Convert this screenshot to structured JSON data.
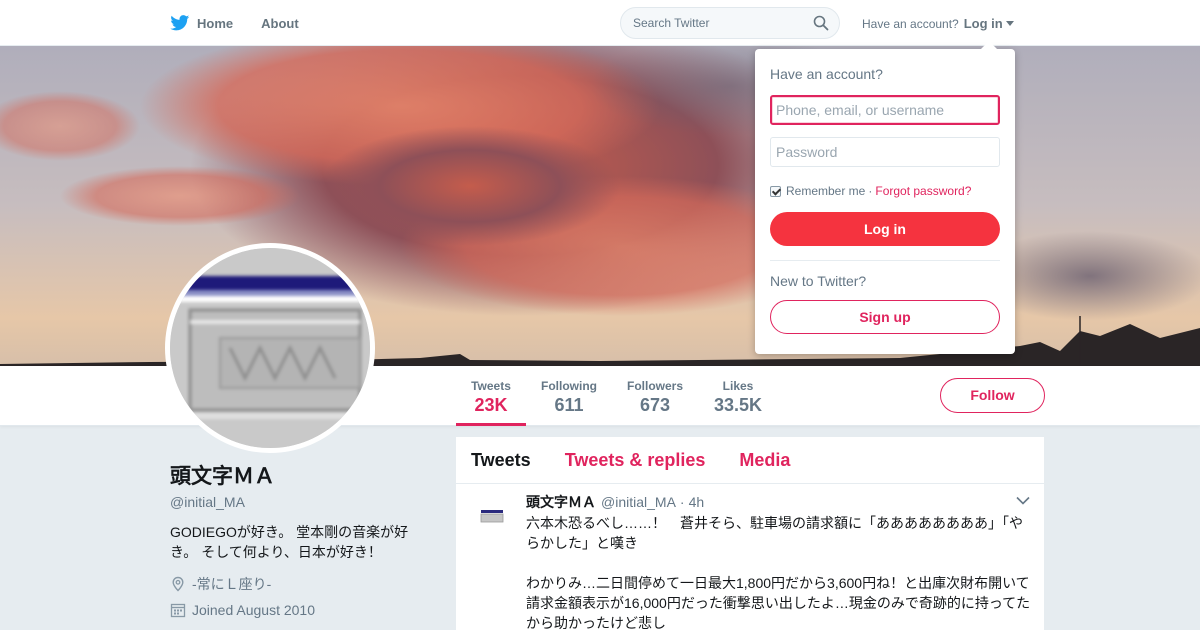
{
  "nav": {
    "home_label": "Home",
    "about_label": "About",
    "search_placeholder": "Search Twitter",
    "have_account_label": "Have an account?",
    "login_label": "Log in"
  },
  "login_dropdown": {
    "title": "Have an account?",
    "username_placeholder": "Phone, email, or username",
    "password_placeholder": "Password",
    "remember_label": "Remember me",
    "separator": "·",
    "forgot_label": "Forgot password?",
    "login_button": "Log in",
    "new_label": "New to Twitter?",
    "signup_button": "Sign up"
  },
  "stats": [
    {
      "label": "Tweets",
      "value": "23K"
    },
    {
      "label": "Following",
      "value": "611"
    },
    {
      "label": "Followers",
      "value": "673"
    },
    {
      "label": "Likes",
      "value": "33.5K"
    }
  ],
  "follow_button": "Follow",
  "profile": {
    "display_name": "頭文字ＭＡ",
    "screen_name": "@initial_MA",
    "bio": "GODIEGOが好き。 堂本剛の音楽が好き。 そして何より、日本が好き！",
    "location": "-常にＬ座り-",
    "joined": "Joined August 2010"
  },
  "timeline": {
    "tabs": [
      "Tweets",
      "Tweets & replies",
      "Media"
    ],
    "tweet": {
      "name": "頭文字ＭＡ",
      "handle": "@initial_MA",
      "dot": "·",
      "time": "4h",
      "text": "六本木恐るべし……！　蒼井そら、駐車場の請求額に「ああああああああ」「やらかした」と嘆き\n\nわかりみ…二日間停めて一日最大1,800円だから3,600円ね！と出庫次財布開いて請求金額表示が16,000円だった衝撃思い出したよ…現金のみで奇跡的に持ってたから助かったけど悲し"
    }
  },
  "colors": {
    "accent": "#e0245e",
    "login_button": "#f5333f",
    "twitter_blue": "#1da1f2"
  },
  "icons": [
    "twitter-bird-icon",
    "search-icon",
    "caret-down-icon",
    "location-icon",
    "calendar-icon",
    "chevron-down-icon"
  ]
}
